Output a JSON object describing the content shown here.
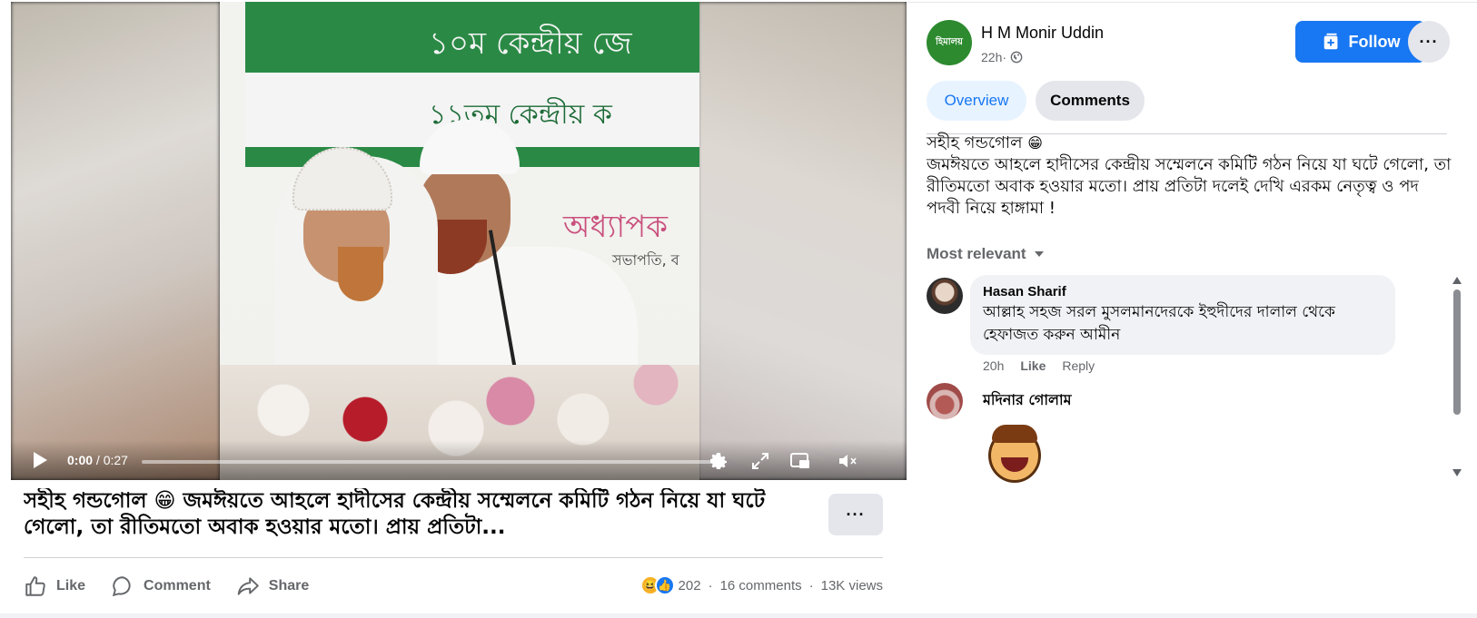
{
  "video": {
    "banner_top_text": "১০ম কেন্দ্রীয় জে",
    "banner_mid_text": "১১তম কেন্দ্রীয় ক",
    "pink_text": "অধ্যাপক",
    "small_text": "সভাপতি, ব",
    "time_current": "0:00",
    "time_separator": " / ",
    "time_total": "0:27",
    "progress_fraction": 0.0
  },
  "caption": {
    "text": "সহীহ গন্ডগোল 😁 জমঈয়তে আহলে হাদীসের কেন্দ্রীয় সম্মেলনে কমিটি গঠন নিয়ে যা ঘটে গেলো, তা রীতিমতো অবাক হওয়ার মতো। প্রায় প্রতিটা...",
    "more_label": "···"
  },
  "actions": {
    "like": "Like",
    "comment": "Comment",
    "share": "Share"
  },
  "stats": {
    "reaction_count": "202",
    "comments": "16 comments",
    "views": "13K views",
    "separator": "·"
  },
  "panel": {
    "page_avatar_text": "হিমালয়",
    "page_name": "H M Monir Uddin",
    "time": "22h",
    "meta_separator": " · ",
    "follow_label": "Follow",
    "more_label": "···",
    "tabs": [
      {
        "label": "Overview"
      },
      {
        "label": "Comments"
      }
    ],
    "post_line1": "সহীহ গন্ডগোল",
    "post_emoji": "😁",
    "post_body": "জমঈয়তে আহলে হাদীসের কেন্দ্রীয় সম্মেলনে কমিটি গঠন নিয়ে যা ঘটে গেলো, তা রীতিমতো অবাক হওয়ার মতো। প্রায় প্রতিটা দলেই দেখি এরকম নেতৃত্ব ও পদ পদবী নিয়ে হাঙ্গামা !",
    "sort_label": "Most relevant"
  },
  "comments": [
    {
      "author": "Hasan Sharif",
      "body": "আল্লাহ সহজ সরল মুসলমানদেরকে ইহুদীদের দালাল থেকে হেফাজত করুন আমীন",
      "time": "20h",
      "like": "Like",
      "reply": "Reply"
    },
    {
      "author": "মদিনার গোলাম"
    }
  ],
  "colors": {
    "accent": "#1877f2",
    "muted": "#65676b",
    "bubble": "#f0f2f5"
  }
}
